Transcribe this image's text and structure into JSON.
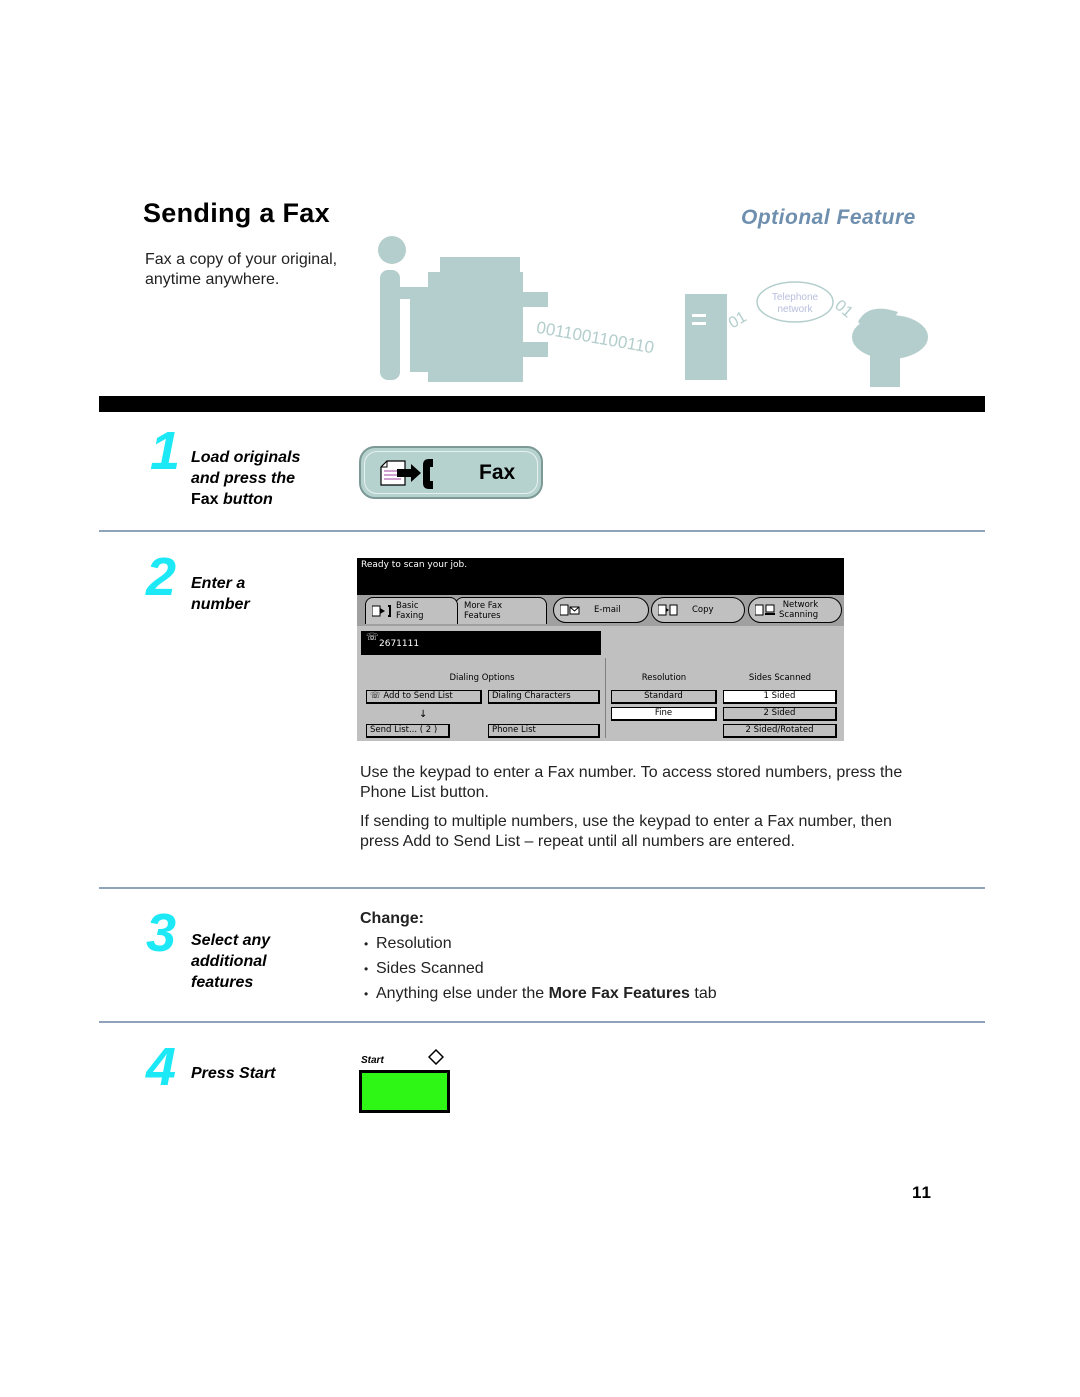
{
  "header": {
    "title": "Sending a Fax",
    "badge": "Optional Feature",
    "intro": "Fax a copy of your original, anytime anywhere."
  },
  "illustration": {
    "bits_left": "0011001100110",
    "bits_mid": "01",
    "bits_right": "01",
    "cloud_line1": "Telephone",
    "cloud_line2": "network"
  },
  "steps": [
    {
      "number": "1",
      "label_line1": "Load originals",
      "label_line2": "and press the",
      "label_bold": "Fax",
      "label_tail": " button"
    },
    {
      "number": "2",
      "label_line1": "Enter a",
      "label_line2": "number"
    },
    {
      "number": "3",
      "label_line1": "Select any",
      "label_line2": "additional",
      "label_line3": "features"
    },
    {
      "number": "4",
      "label_line1": "Press Start"
    }
  ],
  "fax_button": {
    "label": "Fax"
  },
  "screen": {
    "message": "Ready to scan your job.",
    "tabs": [
      {
        "line1": "Basic",
        "line2": "Faxing",
        "icon": "fax-icon",
        "active": true
      },
      {
        "line1": "More Fax",
        "line2": "Features",
        "active": false
      },
      {
        "line1": "E-mail",
        "icon": "email-icon"
      },
      {
        "line1": "Copy",
        "icon": "copy-icon"
      },
      {
        "line1": "Network",
        "line2": "Scanning",
        "icon": "network-scan-icon"
      }
    ],
    "number_value": "2671111",
    "dialing_options": {
      "title": "Dialing Options",
      "add_to_send_list": "Add to Send List",
      "dialing_characters": "Dialing Characters",
      "send_list": "Send List... ( 2 )",
      "phone_list": "Phone List"
    },
    "resolution": {
      "title": "Resolution",
      "options": [
        "Standard",
        "Fine"
      ],
      "selected": "Fine"
    },
    "sides_scanned": {
      "title": "Sides Scanned",
      "options": [
        "1 Sided",
        "2 Sided",
        "2 Sided/Rotated"
      ],
      "selected": "1 Sided"
    }
  },
  "step2_text": {
    "para1": "Use the keypad to enter a Fax number. To access stored numbers, press the Phone List button.",
    "para2": "If sending to multiple numbers, use the keypad to enter a Fax number, then press Add to Send List – repeat until all numbers are entered."
  },
  "step3_text": {
    "title": "Change:",
    "bullets": [
      "Resolution",
      "Sides Scanned"
    ],
    "bullet3_prefix": "Anything else under the ",
    "bullet3_bold": "More Fax Features",
    "bullet3_suffix": " tab"
  },
  "start_button": {
    "label": "Start"
  },
  "page_number": "11",
  "colors": {
    "accent_cyan": "#1de9f6",
    "badge_blue": "#6f8fae",
    "divider": "#8fa3ba",
    "illustration_teal": "#b3cecc",
    "start_green": "#2ef615"
  }
}
